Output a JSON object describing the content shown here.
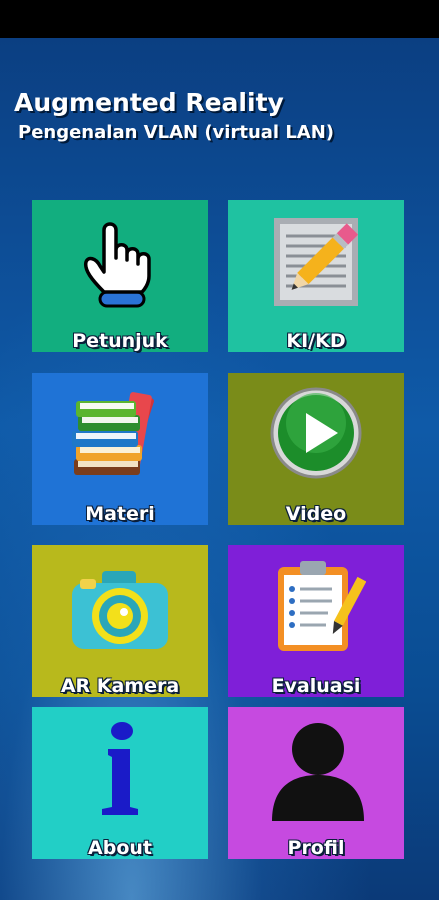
{
  "header": {
    "title": "Augmented Reality",
    "subtitle": "Pengenalan VLAN (virtual LAN)"
  },
  "menu": [
    {
      "label": "Petunjuk",
      "color": "#12ae7f",
      "icon": "hand-pointer-icon"
    },
    {
      "label": "KI/KD",
      "color": "#1fc2a1",
      "icon": "pencil-paper-icon"
    },
    {
      "label": "Materi",
      "color": "#1f73d6",
      "icon": "books-icon"
    },
    {
      "label": "Video",
      "color": "#7a8c19",
      "icon": "play-icon"
    },
    {
      "label": "AR Kamera",
      "color": "#b8b91c",
      "icon": "camera-icon"
    },
    {
      "label": "Evaluasi",
      "color": "#7f1fd8",
      "icon": "clipboard-icon"
    },
    {
      "label": "About",
      "color": "#22cfc6",
      "icon": "info-icon"
    },
    {
      "label": "Profil",
      "color": "#c64ae0",
      "icon": "person-icon"
    }
  ]
}
